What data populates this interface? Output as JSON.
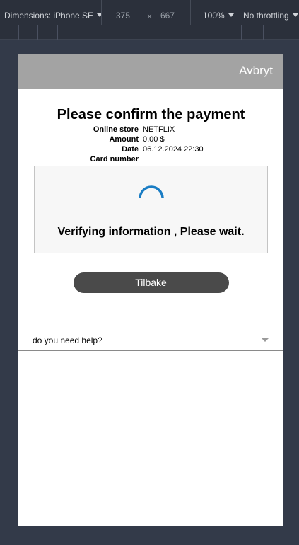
{
  "devtools": {
    "device_label": "Dimensions: iPhone SE",
    "width": "375",
    "times": "×",
    "height": "667",
    "zoom": "100%",
    "throttling": "No throttling"
  },
  "header": {
    "cancel_label": "Avbryt"
  },
  "payment": {
    "title": "Please confirm the payment",
    "rows": [
      {
        "label": "Online store",
        "value": "NETFLIX"
      },
      {
        "label": "Amount",
        "value": "0,00 $"
      },
      {
        "label": "Date",
        "value": "06.12.2024 22:30"
      },
      {
        "label": "Card number",
        "value": ""
      }
    ]
  },
  "verification": {
    "message": "Verifying information , Please wait.",
    "spinner_color": "#1a7dc4"
  },
  "actions": {
    "back_label": "Tilbake"
  },
  "help": {
    "label": "do you need help?"
  }
}
